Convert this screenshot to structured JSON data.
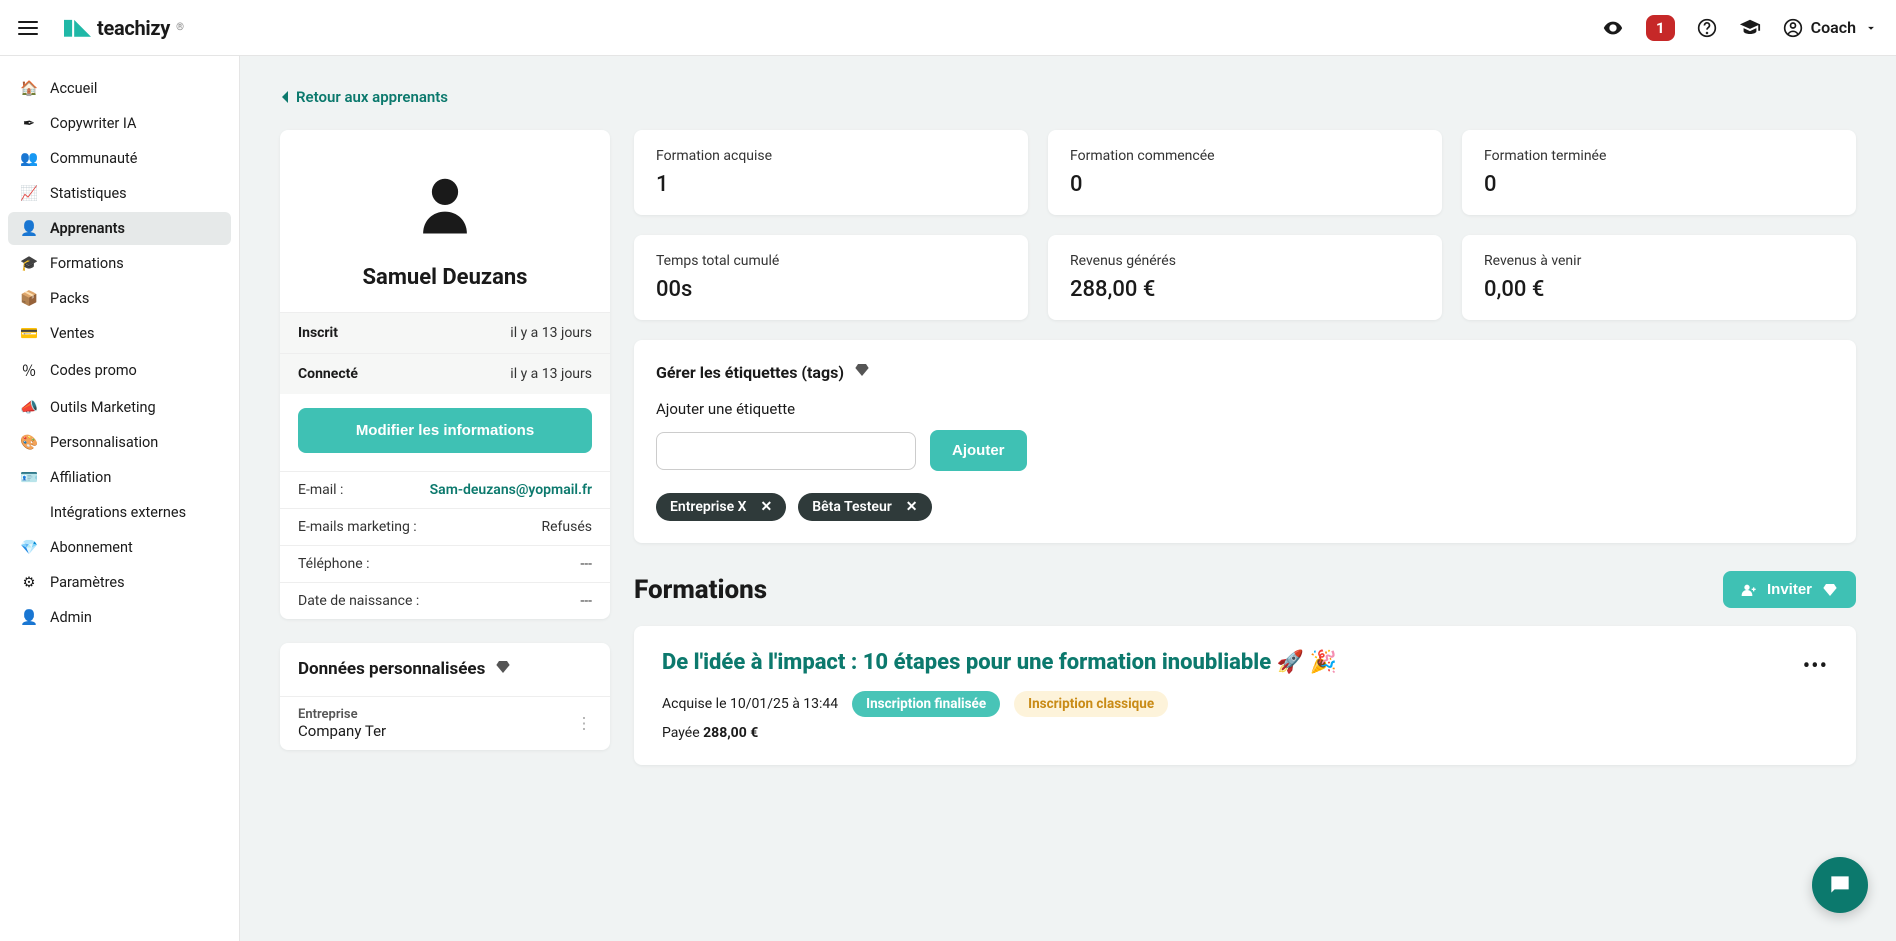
{
  "brand": "teachizy",
  "header": {
    "notif_count": "1",
    "user_label": "Coach"
  },
  "sidebar": {
    "items": [
      {
        "icon": "🏠",
        "label": "Accueil"
      },
      {
        "icon": "✒",
        "label": "Copywriter IA"
      },
      {
        "icon": "👥",
        "label": "Communauté"
      },
      {
        "icon": "📈",
        "label": "Statistiques"
      },
      {
        "icon": "👤",
        "label": "Apprenants"
      },
      {
        "icon": "🎓",
        "label": "Formations"
      },
      {
        "icon": "📦",
        "label": "Packs"
      },
      {
        "icon": "💳",
        "label": "Ventes"
      },
      {
        "icon": "％",
        "label": "Codes promo"
      },
      {
        "icon": "📣",
        "label": "Outils Marketing"
      },
      {
        "icon": "🎨",
        "label": "Personnalisation"
      },
      {
        "icon": "🪪",
        "label": "Affiliation"
      },
      {
        "icon": "</>",
        "label": "Intégrations externes"
      },
      {
        "icon": "💎",
        "label": "Abonnement"
      },
      {
        "icon": "⚙",
        "label": "Paramètres"
      },
      {
        "icon": "👤",
        "label": "Admin"
      }
    ],
    "active_index": 4
  },
  "back_link": "Retour aux apprenants",
  "profile": {
    "name": "Samuel Deuzans",
    "rows": [
      {
        "label": "Inscrit",
        "value": "il y a 13 jours"
      },
      {
        "label": "Connecté",
        "value": "il y a 13 jours"
      }
    ],
    "edit_btn": "Modifier les informations",
    "details": [
      {
        "label": "E-mail :",
        "value": "Sam-deuzans@yopmail.fr",
        "link": true
      },
      {
        "label": "E-mails marketing :",
        "value": "Refusés"
      },
      {
        "label": "Téléphone :",
        "value": "---"
      },
      {
        "label": "Date de naissance :",
        "value": "---"
      }
    ]
  },
  "custom": {
    "title": "Données personnalisées",
    "fields": [
      {
        "label": "Entreprise",
        "value": "Company Ter"
      }
    ]
  },
  "stats": [
    {
      "label": "Formation acquise",
      "value": "1"
    },
    {
      "label": "Formation commencée",
      "value": "0"
    },
    {
      "label": "Formation terminée",
      "value": "0"
    },
    {
      "label": "Temps total cumulé",
      "value": "00s"
    },
    {
      "label": "Revenus générés",
      "value": "288,00 €"
    },
    {
      "label": "Revenus à venir",
      "value": "0,00 €"
    }
  ],
  "tags": {
    "title": "Gérer les étiquettes (tags)",
    "sub": "Ajouter une étiquette",
    "add_btn": "Ajouter",
    "chips": [
      "Entreprise X",
      "Bêta Testeur"
    ]
  },
  "formations": {
    "title": "Formations",
    "invite_btn": "Inviter",
    "item": {
      "title": "De l'idée à l'impact : 10 étapes pour une formation inoubliable 🚀 🎉",
      "date": "Acquise le 10/01/25 à 13:44",
      "badge1": "Inscription finalisée",
      "badge2": "Inscription classique",
      "paid_label": "Payée ",
      "paid_amount": "288,00 €"
    }
  }
}
